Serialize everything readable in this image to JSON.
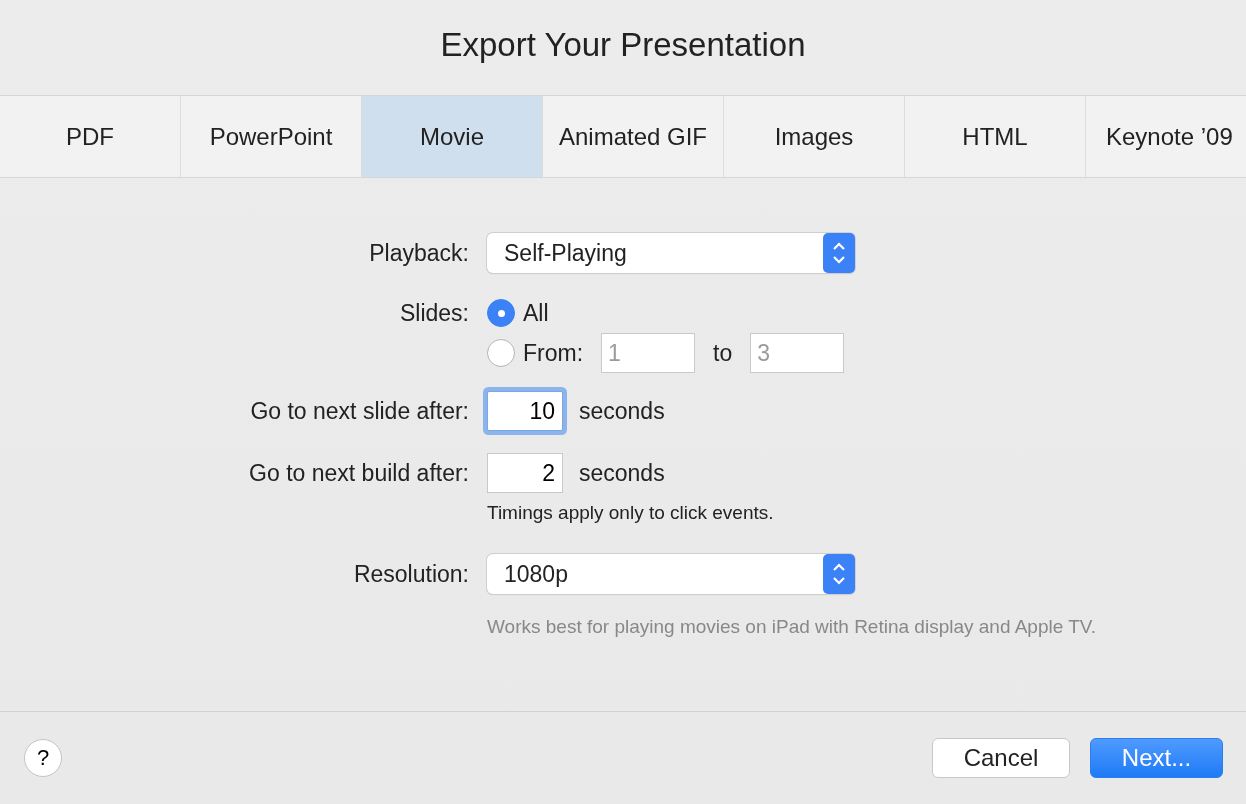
{
  "title": "Export Your Presentation",
  "tabs": [
    {
      "label": "PDF",
      "selected": false
    },
    {
      "label": "PowerPoint",
      "selected": false
    },
    {
      "label": "Movie",
      "selected": true
    },
    {
      "label": "Animated GIF",
      "selected": false
    },
    {
      "label": "Images",
      "selected": false
    },
    {
      "label": "HTML",
      "selected": false
    },
    {
      "label": "Keynote ’09",
      "selected": false
    }
  ],
  "playback": {
    "label": "Playback:",
    "value": "Self-Playing"
  },
  "slides": {
    "label": "Slides:",
    "options": [
      {
        "label": "All",
        "selected": true
      },
      {
        "label": "From:",
        "selected": false
      }
    ],
    "from": {
      "value": "1",
      "disabled": true
    },
    "to_label": "to",
    "to": {
      "value": "3",
      "disabled": true
    }
  },
  "slide_delay": {
    "label": "Go to next slide after:",
    "value": "10",
    "unit": "seconds",
    "focused": true
  },
  "build_delay": {
    "label": "Go to next build after:",
    "value": "2",
    "unit": "seconds",
    "focused": false
  },
  "timing_note": "Timings apply only to click events.",
  "resolution": {
    "label": "Resolution:",
    "value": "1080p"
  },
  "resolution_note": "Works best for playing movies on iPad with Retina display and Apple TV.",
  "help_button": "?",
  "buttons": [
    {
      "label": "Cancel",
      "primary": false
    },
    {
      "label": "Next...",
      "primary": true
    }
  ]
}
